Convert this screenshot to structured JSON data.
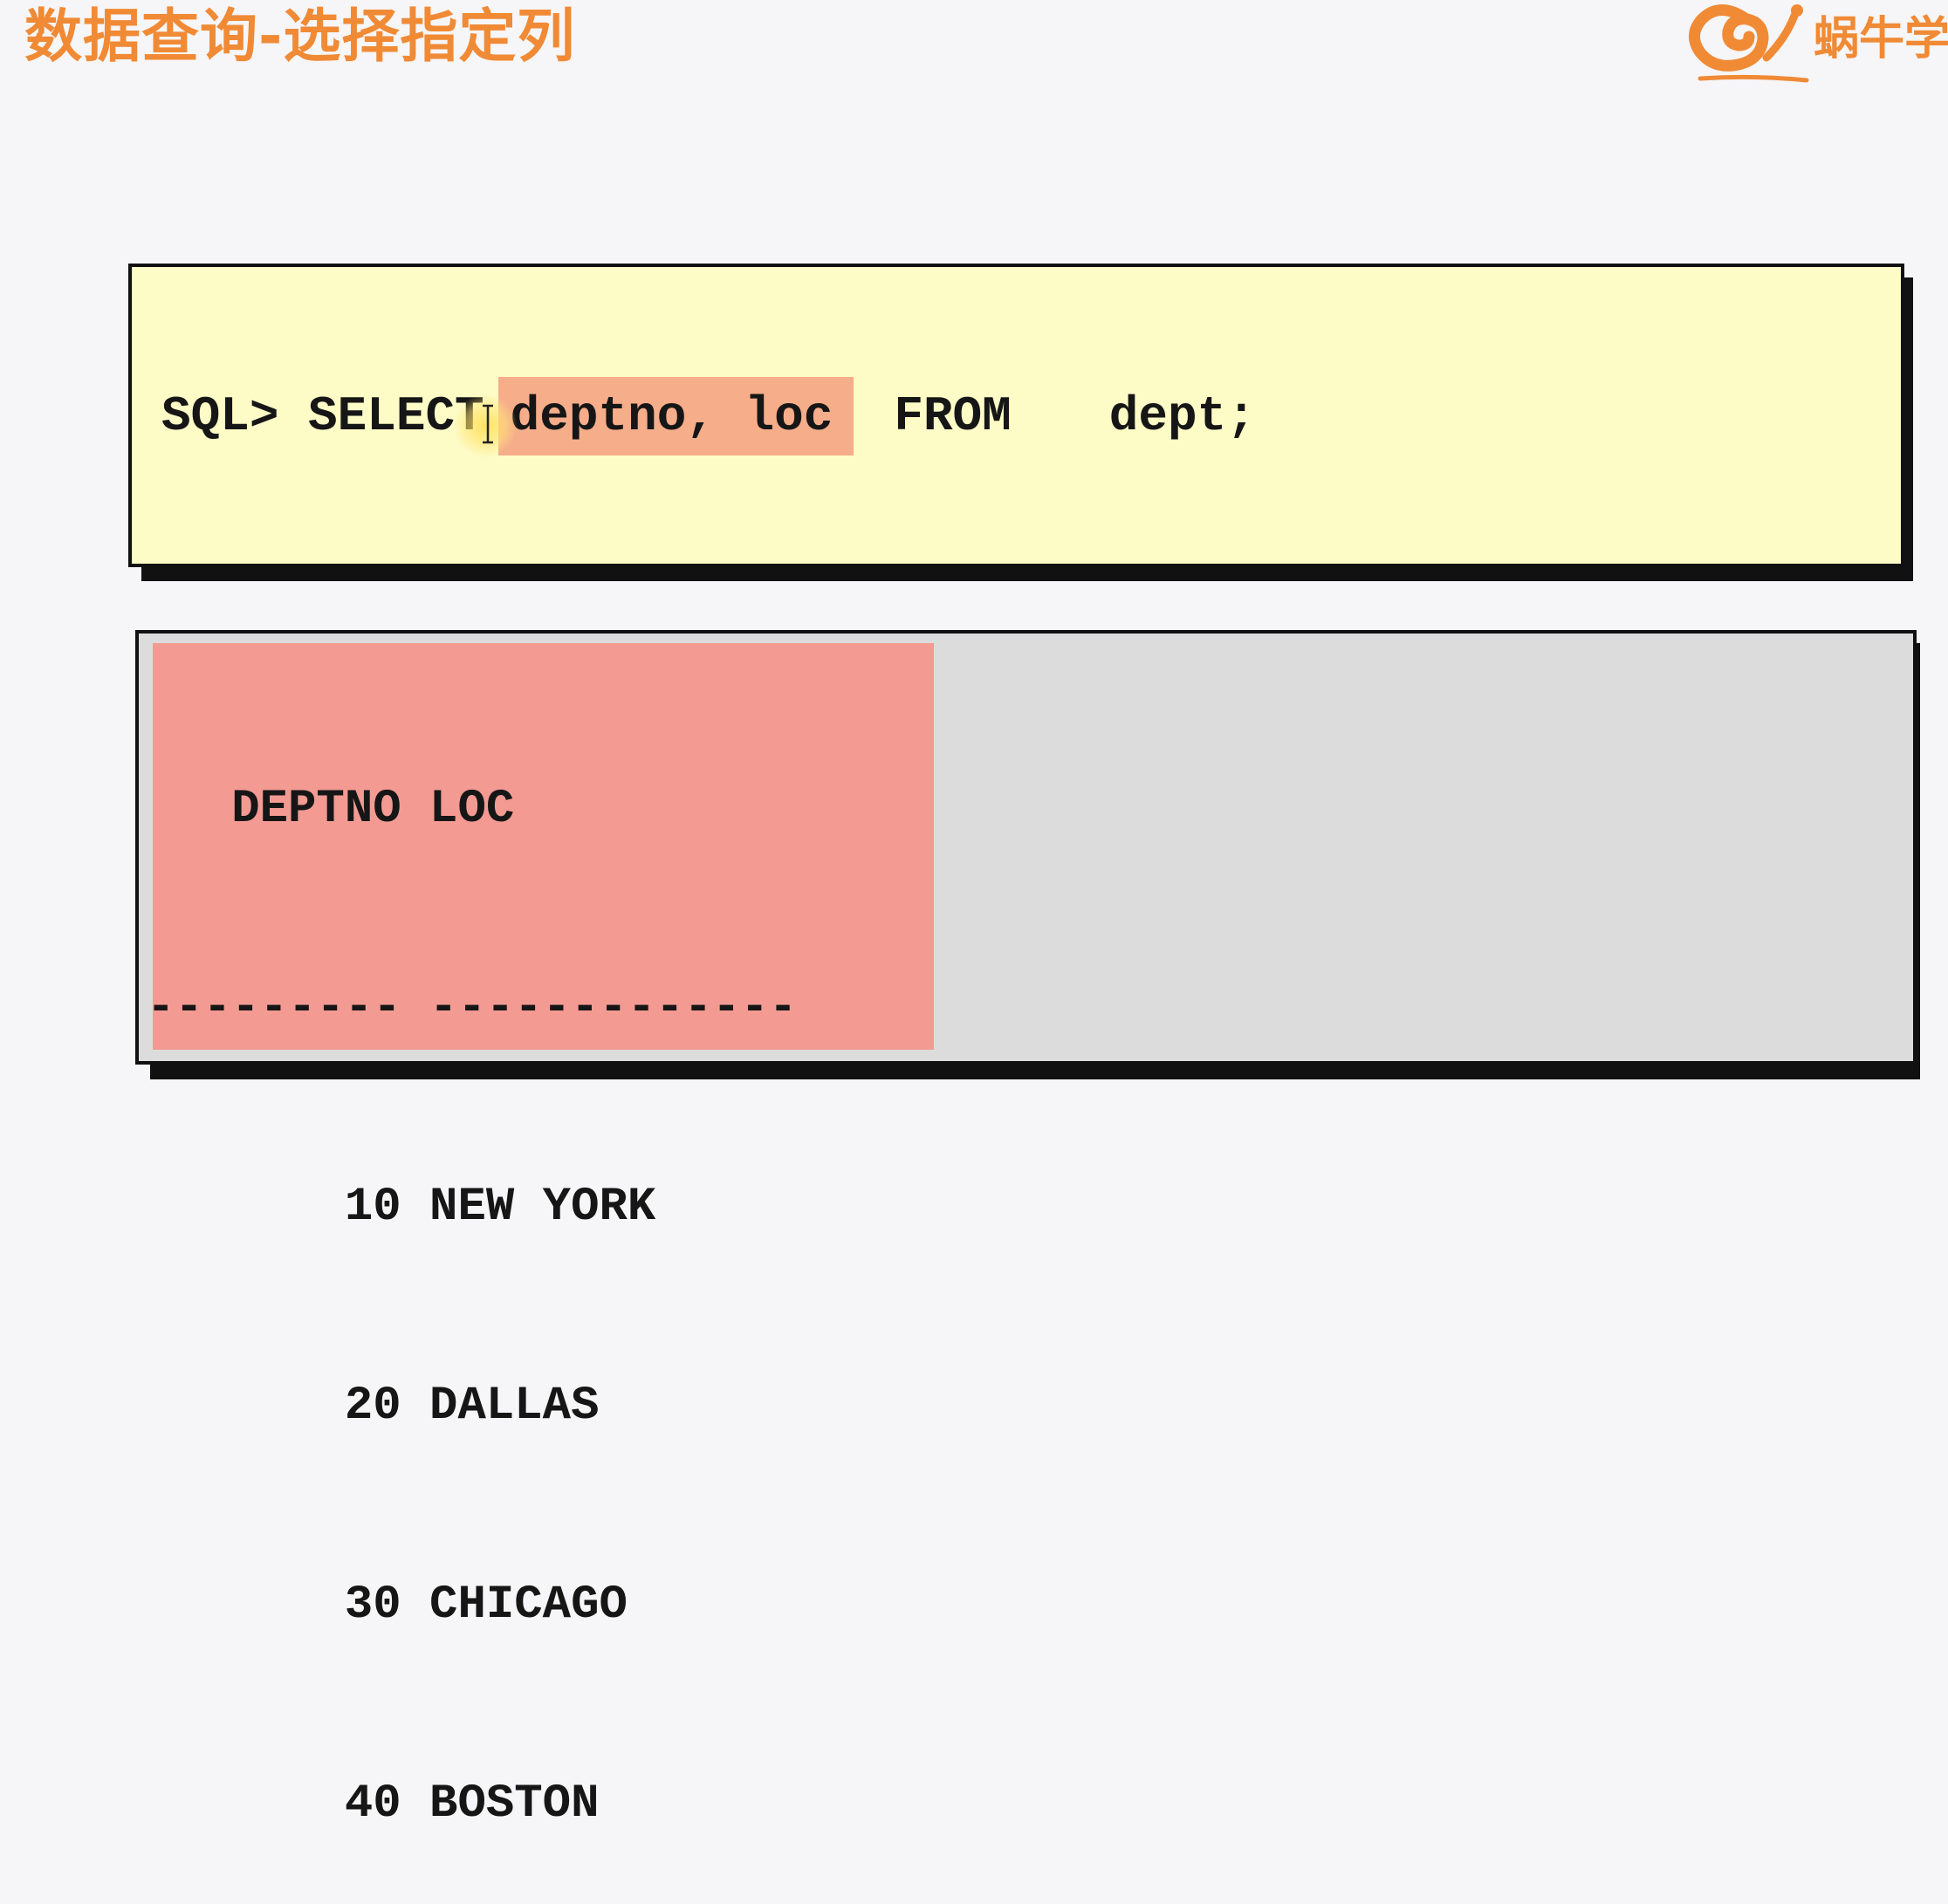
{
  "slide": {
    "title": "数据查询-选择指定列"
  },
  "brand": {
    "name": "蜗牛学",
    "icon": "snail-logo-icon",
    "color": "#f08a35"
  },
  "query": {
    "prompt": "SQL>",
    "keyword_select": "SELECT",
    "columns": "deptno, loc",
    "keyword_from": "FROM",
    "table": "dept;",
    "highlight_color": "#f6ad8a",
    "background_color": "#fdfbc6"
  },
  "result": {
    "header": "   DEPTNO LOC",
    "separator": "--------- -------------",
    "rows": [
      "       10 NEW YORK",
      "       20 DALLAS",
      "       30 CHICAGO",
      "       40 BOSTON"
    ],
    "highlight_color": "#f39a92",
    "background_color": "#dcdcdc"
  }
}
